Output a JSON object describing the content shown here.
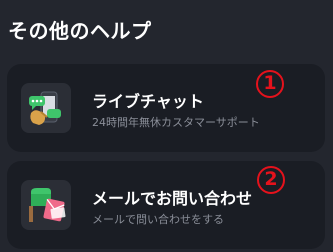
{
  "section": {
    "title": "その他のヘルプ"
  },
  "cards": [
    {
      "label": "ライブチャット",
      "description": "24時間年無休カスタマーサポート",
      "icon": "live-chat-icon",
      "annotation": "1"
    },
    {
      "label": "メールでお問い合わせ",
      "description": "メールで問い合わせをする",
      "icon": "mail-contact-icon",
      "annotation": "2"
    }
  ],
  "colors": {
    "background": "#23262e",
    "card": "#1a1d24",
    "icon_tile": "#2b2e36",
    "description_text": "#8a8e98",
    "annotation_red": "#e5121c",
    "accent_green": "#3fc56b"
  }
}
